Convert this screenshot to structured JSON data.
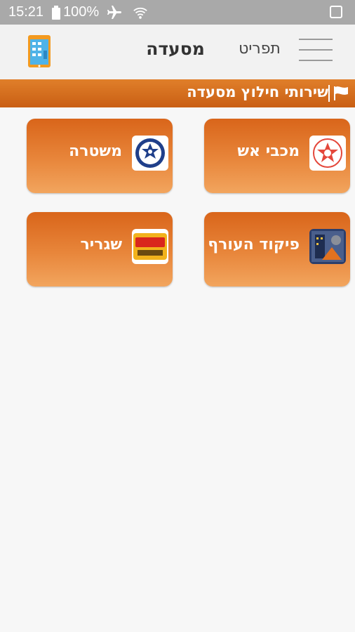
{
  "status_bar": {
    "time": "15:21",
    "battery": "100%",
    "icons": [
      "battery-icon",
      "airplane-mode-icon",
      "wifi-icon",
      "image-notification-icon"
    ]
  },
  "header": {
    "menu_label": "תפריט",
    "title": "מסעדה",
    "logo_icon": "building-phone-logo"
  },
  "section": {
    "title": "שירותי חילוץ מסעדה",
    "icon": "flag-icon"
  },
  "services": [
    {
      "label": "מכבי אש",
      "icon": "fire-service-emblem-icon"
    },
    {
      "label": "משטרה",
      "icon": "police-emblem-icon"
    },
    {
      "label": "פיקוד העורף",
      "icon": "home-front-command-icon"
    },
    {
      "label": "שגריר",
      "icon": "shagrir-logo-icon"
    }
  ],
  "colors": {
    "status_bar": "#a9a9a9",
    "header": "#f2f2f2",
    "band": "#d46e1f",
    "tile": "#e8863b",
    "background": "#f7f7f7"
  }
}
